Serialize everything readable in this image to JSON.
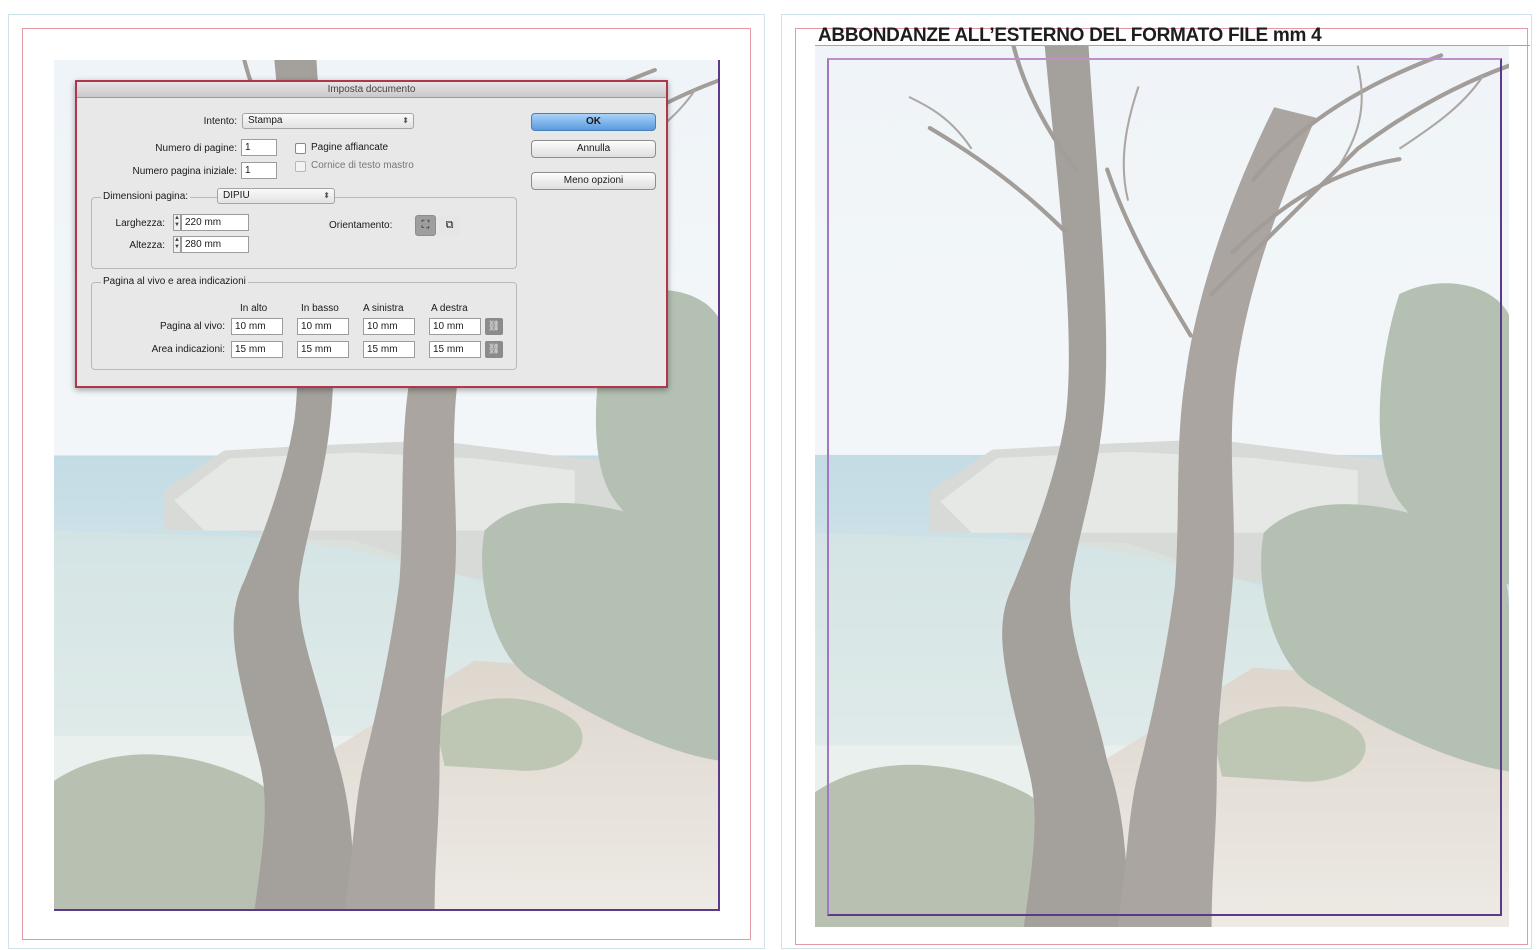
{
  "headline": "ABBONDANZE ALL’ESTERNO DEL FORMATO FILE mm 4",
  "dialog": {
    "title": "Imposta documento",
    "intent_label": "Intento:",
    "intent_value": "Stampa",
    "pages_label": "Numero di pagine:",
    "pages_value": "1",
    "start_page_label": "Numero pagina iniziale:",
    "start_page_value": "1",
    "facing_pages_label": "Pagine affiancate",
    "master_frame_label": "Cornice di testo mastro",
    "page_size_label": "Dimensioni pagina:",
    "page_size_value": "DIPIU",
    "width_label": "Larghezza:",
    "width_value": "220 mm",
    "height_label": "Altezza:",
    "height_value": "280 mm",
    "orientation_label": "Orientamento:",
    "bleed_section_label": "Pagina al vivo e area indicazioni",
    "col_top": "In alto",
    "col_bottom": "In basso",
    "col_left": "A sinistra",
    "col_right": "A destra",
    "bleed_label": "Pagina al vivo:",
    "bleed_top": "10 mm",
    "bleed_bottom": "10 mm",
    "bleed_left": "10 mm",
    "bleed_right": "10 mm",
    "slug_label": "Area indicazioni:",
    "slug_top": "15 mm",
    "slug_bottom": "15 mm",
    "slug_left": "15 mm",
    "slug_right": "15 mm",
    "ok_label": "OK",
    "cancel_label": "Annulla",
    "fewer_options_label": "Meno opzioni"
  },
  "colors": {
    "bleed_guide": "#e39aa6",
    "page_trim": "#5b3a8c",
    "dialog_border": "#b0374a",
    "default_button": "#5a9ae0"
  }
}
